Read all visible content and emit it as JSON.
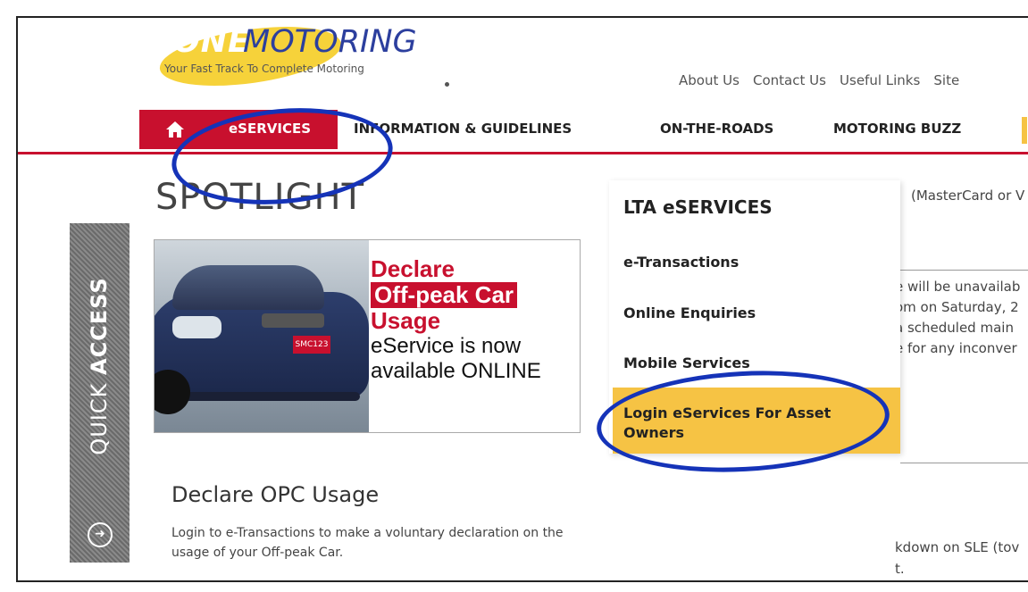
{
  "brand": {
    "one": "ONE",
    "motoring": "MOTORING",
    "tagline": "Your Fast Track To Complete Motoring"
  },
  "toplinks": [
    "About Us",
    "Contact Us",
    "Useful Links",
    "Site"
  ],
  "nav": {
    "eservices": "eSERVICES",
    "info": "INFORMATION & GUIDELINES",
    "roads": "ON-THE-ROADS",
    "buzz": "MOTORING BUZZ"
  },
  "spotlight": {
    "title": "SPOTLIGHT",
    "quick_prefix": "QUICK ",
    "quick_bold": "ACCESS",
    "promo_line1": "Declare",
    "promo_line2": "Off-peak Car",
    "promo_line3": "Usage",
    "promo_line4": "eService is now",
    "promo_line5": "available ONLINE",
    "plate": "SMC123",
    "opc_title": "Declare OPC Usage",
    "opc_desc": "Login to e-Transactions to make a voluntary declaration on the usage of your Off-peak Car."
  },
  "dropdown": {
    "heading": "LTA eSERVICES",
    "items": [
      "e-Transactions",
      "Online Enquiries",
      "Mobile Services"
    ],
    "login": "Login eServices For Asset Owners"
  },
  "right_bg": {
    "card": "(MasterCard or V",
    "line1": "e will be unavailab",
    "line2": "om on Saturday, 2",
    "line3": "a scheduled main",
    "line4": "e for any inconver",
    "line5": "kdown on SLE (tov",
    "line6": "t."
  },
  "colors": {
    "brand_red": "#c8102e",
    "highlight_yellow": "#f6c344",
    "annotation_blue": "#1533b8",
    "logo_blue": "#2c3f9e"
  }
}
